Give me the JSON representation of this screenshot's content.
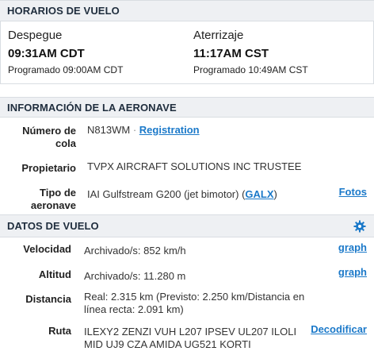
{
  "schedule": {
    "header": "HORARIOS DE VUELO",
    "departure": {
      "label": "Despegue",
      "time": "09:31AM CDT",
      "scheduled": "Programado 09:00AM CDT"
    },
    "arrival": {
      "label": "Aterrizaje",
      "time": "11:17AM CST",
      "scheduled": "Programado 10:49AM CST"
    }
  },
  "aircraft": {
    "header": "INFORMACIÓN DE LA AERONAVE",
    "tail_label_1": "Número de",
    "tail_label_2": "cola",
    "tail_number": "N813WM",
    "separator": "·",
    "registration_link": "Registration",
    "owner_label": "Propietario",
    "owner_value": "TVPX AIRCRAFT SOLUTIONS INC TRUSTEE",
    "type_label_1": "Tipo de",
    "type_label_2": "aeronave",
    "type_value_prefix": "IAI Gulfstream G200 (jet bimotor) (",
    "type_code_link": "GALX",
    "type_value_suffix": ")",
    "photos_link": "Fotos"
  },
  "flight_data": {
    "header": "DATOS DE VUELO",
    "settings_icon": "gear-icon",
    "speed_label": "Velocidad",
    "speed_value": "Archivado/s: 852 km/h",
    "speed_graph_link": "graph",
    "altitude_label": "Altitud",
    "altitude_value": "Archivado/s: 11.280 m",
    "altitude_graph_link": "graph",
    "distance_label": "Distancia",
    "distance_line_1": "Real: 2.315 km (Previsto: 2.250 km/Distancia en",
    "distance_line_2": "línea recta: 2.091 km)",
    "route_label": "Ruta",
    "route_line_1": "ILEXY2 ZENZI VUH L207 IPSEV UL207 ILOLI",
    "route_line_2": "MID UJ9 CZA AMIDA UG521 KORTI",
    "decode_link": "Decodificar"
  },
  "colors": {
    "header_bg": "#eef0f3",
    "link": "#1b79c9"
  }
}
